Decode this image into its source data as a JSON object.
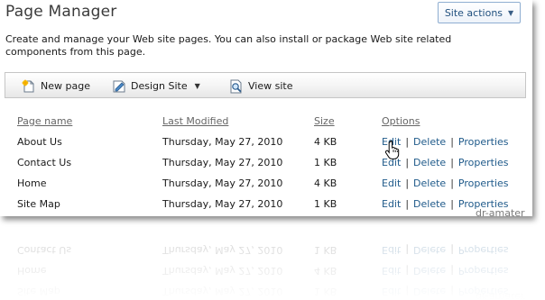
{
  "header": {
    "title": "Page Manager",
    "site_actions_label": "Site actions"
  },
  "description": "Create and manage your Web site pages. You can also install or package Web site related components from this page.",
  "toolbar": {
    "new_page": "New page",
    "design_site": "Design Site",
    "view_site": "View site"
  },
  "table": {
    "columns": [
      "Page name",
      "Last Modified",
      "Size",
      "Options"
    ],
    "rows": [
      {
        "name": "About Us",
        "modified": "Thursday, May 27, 2010",
        "size": "4 KB"
      },
      {
        "name": "Contact Us",
        "modified": "Thursday, May 27, 2010",
        "size": "1 KB"
      },
      {
        "name": "Home",
        "modified": "Thursday, May 27, 2010",
        "size": "4 KB"
      },
      {
        "name": "Site Map",
        "modified": "Thursday, May 27, 2010",
        "size": "1 KB"
      }
    ],
    "options": {
      "edit": "Edit",
      "delete": "Delete",
      "properties": "Properties",
      "separator": "|"
    }
  },
  "watermark": "dr-amater",
  "colors": {
    "link": "#1f5a8a",
    "header_text": "#666666",
    "border": "#c6c6c6"
  }
}
